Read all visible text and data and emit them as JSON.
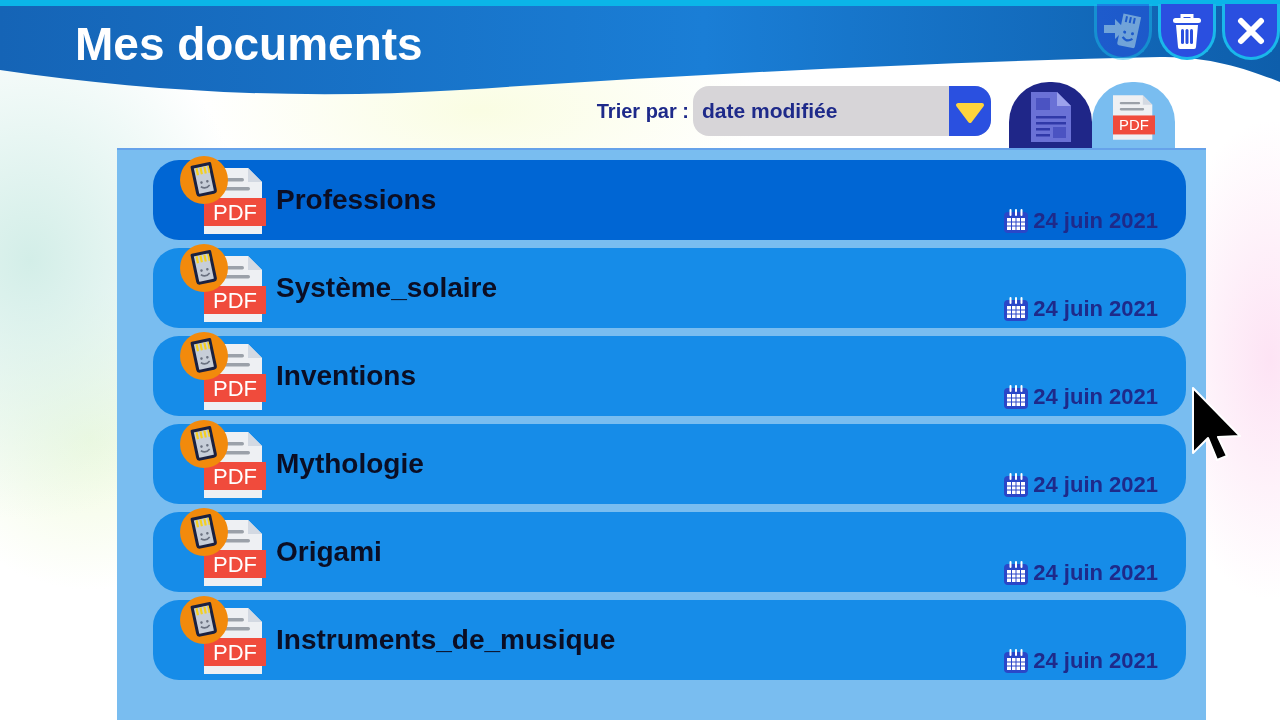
{
  "header": {
    "title": "Mes documents",
    "buttons": [
      {
        "kind": "import",
        "disabled": true
      },
      {
        "kind": "delete",
        "disabled": false
      },
      {
        "kind": "close",
        "disabled": false
      }
    ]
  },
  "sort": {
    "label": "Trier par :",
    "value": "date modifiée"
  },
  "tabs": [
    {
      "kind": "document",
      "selected": false
    },
    {
      "kind": "pdf",
      "icon_label": "PDF",
      "selected": true
    }
  ],
  "files": [
    {
      "name": "Professions",
      "type_label": "PDF",
      "date": "24 juin 2021",
      "selected": true
    },
    {
      "name": "Système_solaire",
      "type_label": "PDF",
      "date": "24 juin 2021",
      "selected": false
    },
    {
      "name": "Inventions",
      "type_label": "PDF",
      "date": "24 juin 2021",
      "selected": false
    },
    {
      "name": "Mythologie",
      "type_label": "PDF",
      "date": "24 juin 2021",
      "selected": false
    },
    {
      "name": "Origami",
      "type_label": "PDF",
      "date": "24 juin 2021",
      "selected": false
    },
    {
      "name": "Instruments_de_musique",
      "type_label": "PDF",
      "date": "24 juin 2021",
      "selected": false
    }
  ]
}
